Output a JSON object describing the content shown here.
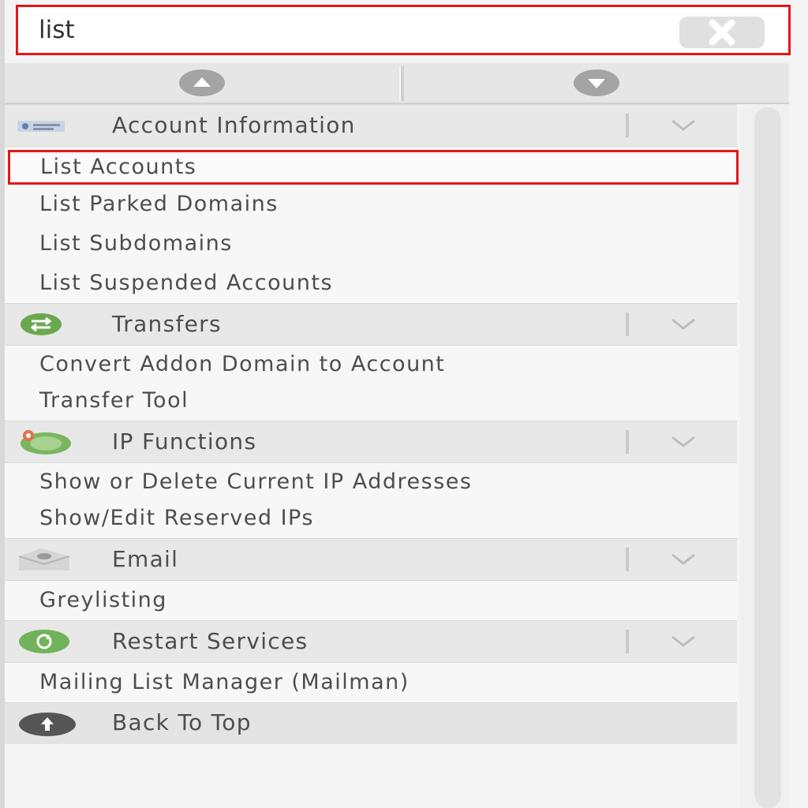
{
  "search": {
    "value": "list",
    "placeholder": ""
  },
  "icons": {
    "clear": "close-icon",
    "up": "arrow-up-icon",
    "down": "arrow-down-icon",
    "collapse": "chevron-down-icon",
    "back_to_top": "arrow-up-circle-icon"
  },
  "colors": {
    "highlight": "#e3161b",
    "transfers_green": "#6aa84f",
    "restart_green": "#71b35a",
    "back_top_dark": "#555555"
  },
  "menu": {
    "sections": [
      {
        "label": "Account Information",
        "icon": "account-card-icon",
        "items": [
          "List Accounts",
          "List Parked Domains",
          "List Subdomains",
          "List Suspended Accounts"
        ]
      },
      {
        "label": "Transfers",
        "icon": "transfer-icon",
        "items": [
          "Convert Addon Domain to Account",
          "Transfer Tool"
        ]
      },
      {
        "label": "IP Functions",
        "icon": "ip-globe-icon",
        "items": [
          "Show or Delete Current IP Addresses",
          "Show/Edit Reserved IPs"
        ]
      },
      {
        "label": "Email",
        "icon": "email-envelope-icon",
        "items": [
          "Greylisting"
        ]
      },
      {
        "label": "Restart Services",
        "icon": "restart-icon",
        "items": [
          "Mailing List Manager (Mailman)"
        ]
      }
    ],
    "back_to_top": "Back To Top",
    "selected_item": "List Accounts"
  }
}
